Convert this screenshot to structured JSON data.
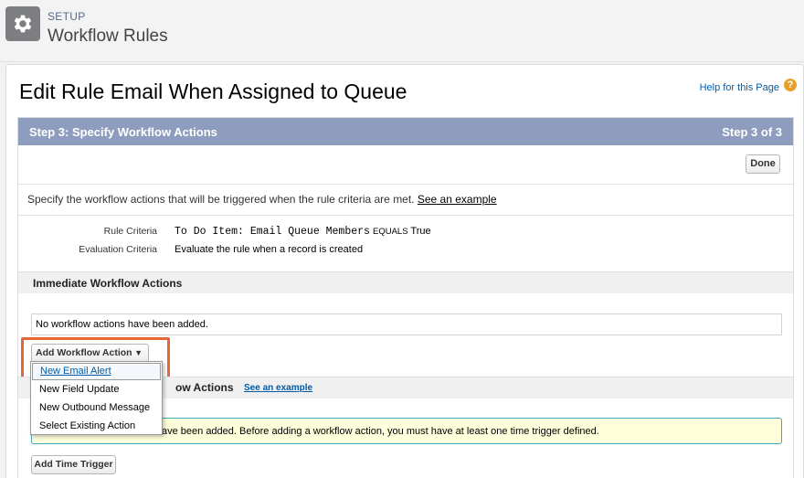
{
  "header": {
    "setup_label": "SETUP",
    "title": "Workflow Rules"
  },
  "page": {
    "title": "Edit Rule Email When Assigned to Queue",
    "help_link": "Help for this Page",
    "help_icon": "?"
  },
  "step": {
    "title": "Step 3: Specify Workflow Actions",
    "count": "Step 3 of 3",
    "done_label": "Done",
    "description": "Specify the workflow actions that will be triggered when the rule criteria are met.",
    "see_example": "See an example"
  },
  "criteria": {
    "rule_label": "Rule Criteria",
    "rule_field": "To Do Item: Email Queue Members",
    "rule_operator": "EQUALS",
    "rule_value": "True",
    "eval_label": "Evaluation Criteria",
    "eval_value": "Evaluate the rule when a record is created"
  },
  "immediate": {
    "title": "Immediate Workflow Actions",
    "empty_text": "No workflow actions have been added.",
    "add_button": "Add Workflow Action",
    "add_arrow": "▼"
  },
  "time_triggered": {
    "title_visible": "ow Actions",
    "see_example": "See an example",
    "warning_visible": "ave been added. Before adding a workflow action, you must have at least one time trigger defined.",
    "add_time_trigger": "Add Time Trigger"
  },
  "dropdown": {
    "items": [
      {
        "label": "New Email Alert",
        "active": true
      },
      {
        "label": "New Field Update",
        "active": false
      },
      {
        "label": "New Outbound Message",
        "active": false
      },
      {
        "label": "Select Existing Action",
        "active": false
      }
    ]
  },
  "colors": {
    "step_bar": "#8e9dbe",
    "highlight": "#e8653a",
    "link": "#015ba7",
    "warning_bg": "#ffffdc",
    "warning_border": "#40a8b8"
  }
}
